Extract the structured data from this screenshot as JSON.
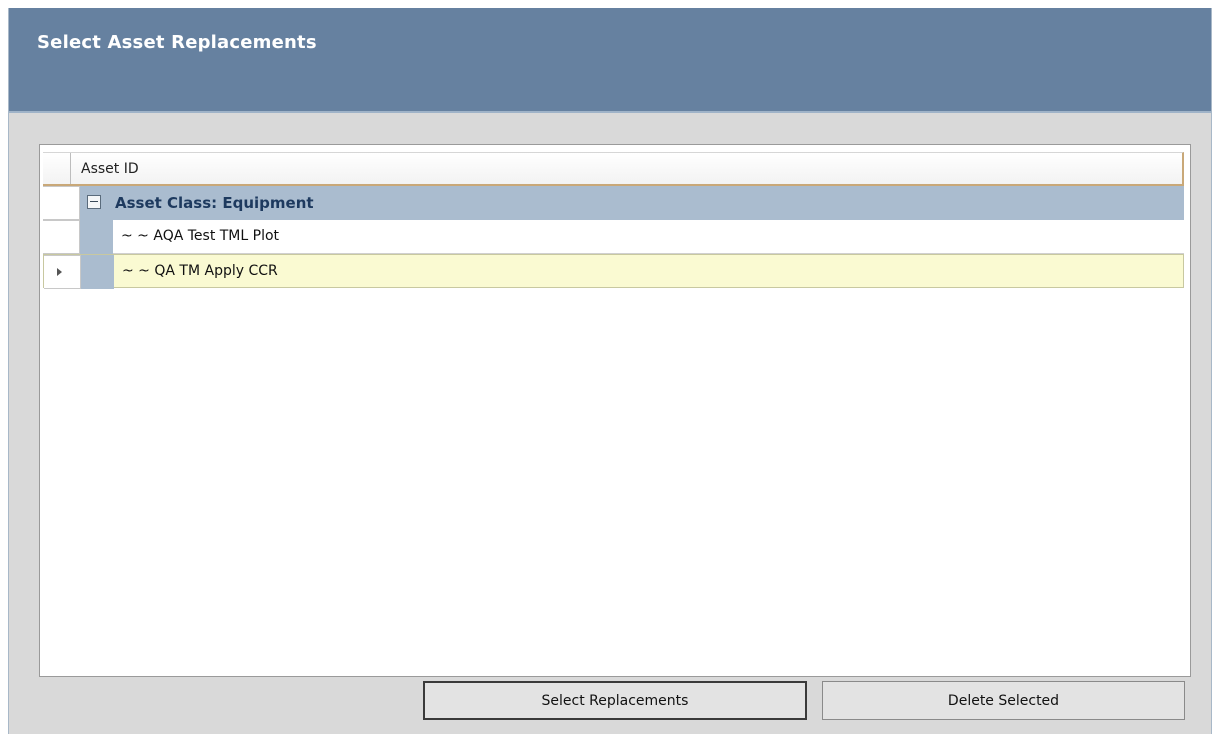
{
  "dialog": {
    "title": "Select Asset Replacements"
  },
  "grid": {
    "column_header": "Asset ID",
    "group": {
      "label": "Asset Class: Equipment",
      "expanded": true
    },
    "rows": [
      {
        "text": "~ ~ AQA Test TML Plot",
        "selected": false
      },
      {
        "text": "~ ~ QA TM Apply CCR",
        "selected": true
      }
    ]
  },
  "buttons": {
    "select_replacements": "Select Replacements",
    "delete_selected": "Delete Selected"
  },
  "colors": {
    "title_bar": "#6681a0",
    "group_row": "#aabccf",
    "selected_row": "#fafad2",
    "dialog_bg": "#d9d9d9"
  },
  "icons": {
    "expander": "collapse-minus-icon",
    "row_indicator": "caret-right-icon"
  }
}
